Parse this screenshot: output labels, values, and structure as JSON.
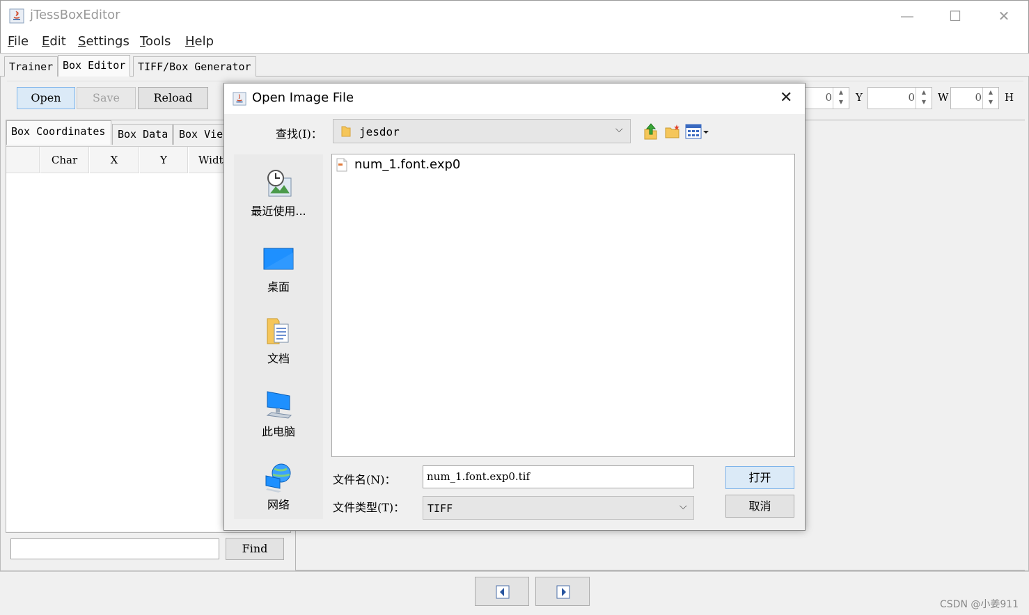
{
  "window": {
    "title": "jTessBoxEditor",
    "minimize": "—",
    "maximize": "☐",
    "close": "✕"
  },
  "menu": [
    {
      "mnemonic": "F",
      "rest": "ile"
    },
    {
      "mnemonic": "E",
      "rest": "dit"
    },
    {
      "mnemonic": "S",
      "rest": "ettings"
    },
    {
      "mnemonic": "T",
      "rest": "ools"
    },
    {
      "mnemonic": "H",
      "rest": "elp"
    }
  ],
  "tabs": [
    "Trainer",
    "Box Editor",
    "TIFF/Box Generator"
  ],
  "toolbar": {
    "open": "Open",
    "save": "Save",
    "reload": "Reload",
    "x_value": "0",
    "y_label": "Y",
    "y_value": "0",
    "w_label": "W",
    "w_value": "0",
    "h_label": "H"
  },
  "left_panel": {
    "subtabs": [
      "Box Coordinates",
      "Box Data",
      "Box Vie"
    ],
    "columns": [
      "Char",
      "X",
      "Y",
      "Widt"
    ],
    "find_button": "Find",
    "find_value": ""
  },
  "dialog": {
    "title": "Open Image File",
    "close": "✕",
    "look_in_label": "查找(I)：",
    "look_in_value": "jesdor",
    "places": [
      "最近使用...",
      "桌面",
      "文档",
      "此电脑",
      "网络"
    ],
    "files": [
      "num_1.font.exp0"
    ],
    "filename_label": "文件名(N)：",
    "filename_value": "num_1.font.exp0.tif",
    "filetype_label": "文件类型(T)：",
    "filetype_value": "TIFF",
    "open_button": "打开",
    "cancel_button": "取消"
  },
  "watermark": "CSDN @小姜911",
  "colors": {
    "accent_border": "#7eb4ea",
    "accent_bg": "#dbeaf7",
    "desktop_blue": "#1e90ff"
  }
}
